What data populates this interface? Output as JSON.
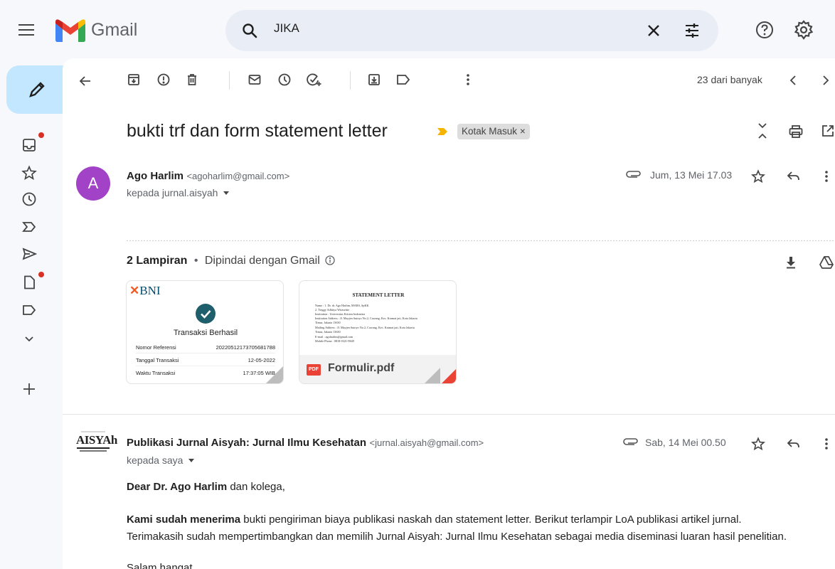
{
  "app": {
    "name": "Gmail",
    "search_query": "JIKA"
  },
  "header_icons": [
    "menu-icon",
    "search-icon",
    "close-icon",
    "tune-icon",
    "help-icon",
    "gear-icon"
  ],
  "colors": {
    "compose_bg": "#c2e7ff",
    "avatar_bg": "#a142c7",
    "badge_red": "#d93025",
    "search_bg": "#e9eef6"
  },
  "toolbar": {
    "pager": "23 dari banyak"
  },
  "thread": {
    "subject": "bukti trf dan form statement letter",
    "label": "Kotak Masuk",
    "label_close": "×"
  },
  "message1": {
    "avatar_letter": "A",
    "sender_name": "Ago Harlim",
    "sender_email": "<agoharlim@gmail.com>",
    "to": "kepada jurnal.aisyah",
    "date": "Jum, 13 Mei 17.03"
  },
  "attachments": {
    "count_label": "2 Lampiran",
    "separator": "•",
    "scan_note": "Dipindai dengan Gmail",
    "bni": {
      "logo_prefix": "✕",
      "logo": "BNI",
      "title": "Transaksi Berhasil",
      "rows": [
        {
          "label": "Nomor Referensi",
          "value": "20220512173705681788"
        },
        {
          "label": "Tanggal Transaksi",
          "value": "12-05-2022"
        },
        {
          "label": "Waktu Transaksi",
          "value": "17:37:05 WIB"
        }
      ]
    },
    "letter": {
      "title": "STATEMENT LETTER",
      "lines": [
        "Name                       : 1. Dr. dr. Ago Harlim, MARS, SpKK",
        "                                 2. Tieggy Adhitya Wirasettie",
        "Institution                : Universitas Kristen Indonesia",
        "Institution Address   : Jl. Mayjen Sutoyo No.2, Cawang, Kec. Kramat jati, Kota Jakarta",
        "                                 Timur, Jakarta 13630",
        "Mailing Address        : Jl. Mayjen Sutoyo No.2, Cawang, Kec. Kramat jati, Kota Jakarta",
        "                                 Timur, Jakarta 13630",
        "E-mail                      : agoharlim@gmail.com",
        "Mobile Phone           : 0818-0321-9849"
      ],
      "badge": "PDF",
      "filename": "Formulir.pdf"
    }
  },
  "message2": {
    "logo_text": "AISYAh",
    "sender_name": "Publikasi Jurnal Aisyah: Jurnal Ilmu Kesehatan",
    "sender_email": "<jurnal.aisyah@gmail.com>",
    "to": "kepada saya",
    "date": "Sab, 14 Mei 00.50",
    "greeting_bold": "Dear Dr. Ago Harlim",
    "greeting_rest": " dan kolega,",
    "para1_bold": "Kami sudah menerima",
    "para1_rest": " bukti pengiriman biaya publikasi naskah dan statement letter. Berikut terlampir LoA publikasi artikel jurnal.",
    "para2": "Terimakasih sudah mempertimbangkan dan memilih Jurnal Aisyah: Jurnal Ilmu Kesehatan sebagai media diseminasi luaran hasil penelitian.",
    "closing": "Salam hangat,"
  }
}
